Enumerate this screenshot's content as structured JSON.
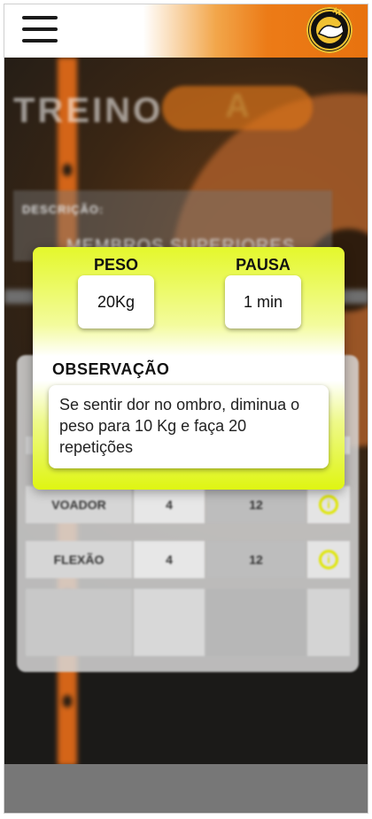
{
  "header": {
    "menu_icon": "hamburger-menu-icon",
    "logo_icon": "gym-logo-icon"
  },
  "background": {
    "title_word": "TREINO",
    "title_letter": "A",
    "description_label": "DESCRIÇÃO:",
    "description_text": "MEMBROS SUPERIORES"
  },
  "table": {
    "rows": [
      {
        "exercise": "VOADOR",
        "sets": "4",
        "reps": "12",
        "icon": "info-icon"
      },
      {
        "exercise": "FLEXÃO",
        "sets": "4",
        "reps": "12",
        "icon": "info-icon"
      }
    ]
  },
  "popup": {
    "weight_label": "PESO",
    "weight_value": "20Kg",
    "rest_label": "PAUSA",
    "rest_value": "1 min",
    "observation_label": "OBSERVAÇÃO",
    "observation_text": "Se sentir dor no ombro, diminua o peso para 10 Kg e faça 20 repetições"
  },
  "colors": {
    "accent_orange": "#e8720e",
    "popup_yellow": "#dff512",
    "info_yellow": "#dfe600"
  }
}
